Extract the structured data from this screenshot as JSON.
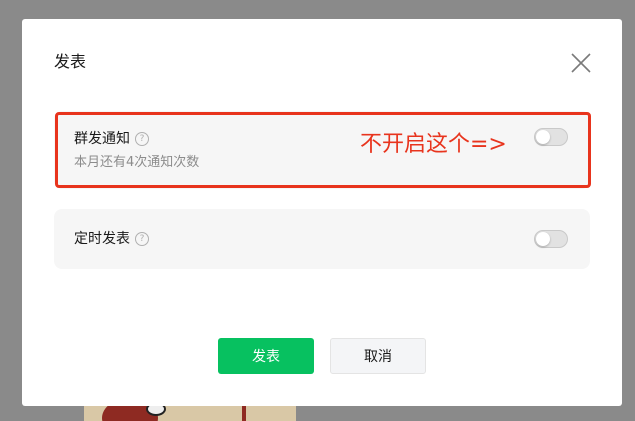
{
  "dialog": {
    "title": "发表"
  },
  "options": [
    {
      "label": "群发通知",
      "description": "本月还有4次通知次数",
      "enabled": false
    },
    {
      "label": "定时发表",
      "enabled": false
    }
  ],
  "annotation": {
    "text": "不开启这个=>",
    "color": "#e8341d"
  },
  "buttons": {
    "primary_label": "发表",
    "secondary_label": "取消"
  },
  "colors": {
    "primary": "#07c160",
    "option_bg": "#f6f6f6",
    "overlay": "#8a8a8a"
  },
  "icons": {
    "close": "close-icon",
    "help": "help-icon"
  }
}
